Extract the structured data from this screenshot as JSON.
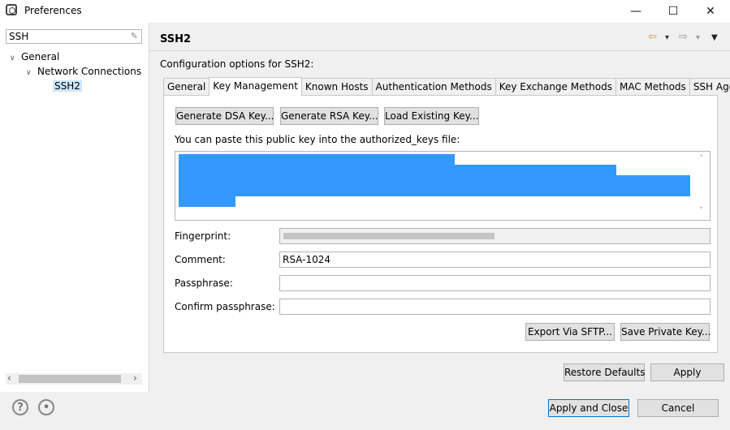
{
  "window": {
    "title": "Preferences",
    "minimize": "—",
    "maximize": "☐",
    "close": "✕"
  },
  "filter": {
    "value": "SSH",
    "clear_glyph": "✎"
  },
  "tree": {
    "general": "General",
    "network": "Network Connections",
    "ssh2": "SSH2",
    "expanded_glyph": "∨"
  },
  "page": {
    "title": "SSH2",
    "config_label": "Configuration options for SSH2:",
    "nav": {
      "back": "⇦",
      "back_menu": "▾",
      "forward": "⇨",
      "forward_menu": "▾",
      "view_menu": "▼"
    }
  },
  "tabs": [
    {
      "label": "General"
    },
    {
      "label": "Key Management"
    },
    {
      "label": "Known Hosts"
    },
    {
      "label": "Authentication Methods"
    },
    {
      "label": "Key Exchange Methods"
    },
    {
      "label": "MAC Methods"
    },
    {
      "label": "SSH Agent"
    }
  ],
  "key_management": {
    "generate_dsa": "Generate DSA Key...",
    "generate_rsa": "Generate RSA Key...",
    "load_existing": "Load Existing Key...",
    "paste_hint": "You can paste this public key into the authorized_keys file:",
    "fingerprint_label": "Fingerprint:",
    "comment_label": "Comment:",
    "comment_value": "RSA-1024",
    "passphrase_label": "Passphrase:",
    "confirm_label": "Confirm passphrase:",
    "export_sftp": "Export Via SFTP...",
    "save_private": "Save Private Key..."
  },
  "page_buttons": {
    "restore": "Restore Defaults",
    "apply": "Apply"
  },
  "dialog_buttons": {
    "apply_close": "Apply and Close",
    "cancel": "Cancel"
  },
  "bottom_icons": {
    "help": "?",
    "import": "•"
  },
  "scroll": {
    "left": "‹",
    "right": "›",
    "up": "˄",
    "down": "˅"
  }
}
